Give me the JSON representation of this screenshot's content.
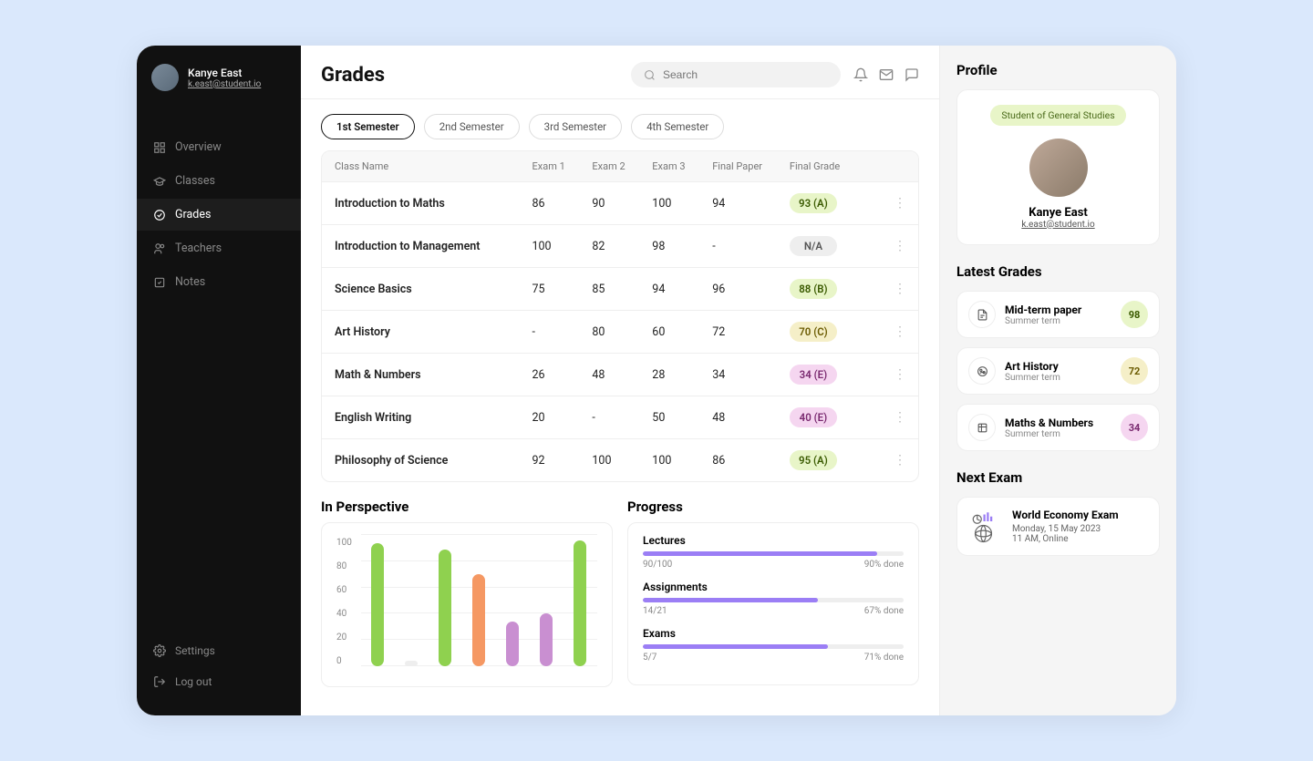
{
  "user": {
    "name": "Kanye East",
    "email": "k.east@student.io"
  },
  "nav": {
    "items": [
      {
        "label": "Overview"
      },
      {
        "label": "Classes"
      },
      {
        "label": "Grades"
      },
      {
        "label": "Teachers"
      },
      {
        "label": "Notes"
      }
    ],
    "footer": [
      {
        "label": "Settings"
      },
      {
        "label": "Log out"
      }
    ]
  },
  "page_title": "Grades",
  "search": {
    "placeholder": "Search"
  },
  "tabs": [
    {
      "label": "1st Semester"
    },
    {
      "label": "2nd Semester"
    },
    {
      "label": "3rd Semester"
    },
    {
      "label": "4th Semester"
    }
  ],
  "table": {
    "headers": [
      "Class Name",
      "Exam 1",
      "Exam 2",
      "Exam 3",
      "Final Paper",
      "Final Grade"
    ],
    "rows": [
      {
        "name": "Introduction to Maths",
        "e1": "86",
        "e2": "90",
        "e3": "100",
        "paper": "94",
        "final": "93 (A)",
        "pill": "green"
      },
      {
        "name": "Introduction to Management",
        "e1": "100",
        "e2": "82",
        "e3": "98",
        "paper": "-",
        "final": "N/A",
        "pill": "gray"
      },
      {
        "name": "Science Basics",
        "e1": "75",
        "e2": "85",
        "e3": "94",
        "paper": "96",
        "final": "88 (B)",
        "pill": "green"
      },
      {
        "name": "Art History",
        "e1": "-",
        "e2": "80",
        "e3": "60",
        "paper": "72",
        "final": "70 (C)",
        "pill": "yellow"
      },
      {
        "name": "Math & Numbers",
        "e1": "26",
        "e2": "48",
        "e3": "28",
        "paper": "34",
        "final": "34 (E)",
        "pill": "pink"
      },
      {
        "name": "English Writing",
        "e1": "20",
        "e2": "-",
        "e3": "50",
        "paper": "48",
        "final": "40 (E)",
        "pill": "pink"
      },
      {
        "name": "Philosophy of Science",
        "e1": "92",
        "e2": "100",
        "e3": "100",
        "paper": "86",
        "final": "95 (A)",
        "pill": "green"
      }
    ]
  },
  "perspective_title": "In Perspective",
  "progress_title": "Progress",
  "chart_data": {
    "type": "bar",
    "ylim": [
      0,
      100
    ],
    "yticks": [
      100,
      80,
      60,
      40,
      20,
      0
    ],
    "series": [
      {
        "value": 93,
        "color": "green"
      },
      {
        "value": 0,
        "color": "gray"
      },
      {
        "value": 88,
        "color": "green"
      },
      {
        "value": 70,
        "color": "orange"
      },
      {
        "value": 34,
        "color": "purple"
      },
      {
        "value": 40,
        "color": "purple"
      },
      {
        "value": 95,
        "color": "green"
      }
    ]
  },
  "progress": [
    {
      "label": "Lectures",
      "done": "90/100",
      "pct": 90,
      "pct_label": "90% done"
    },
    {
      "label": "Assignments",
      "done": "14/21",
      "pct": 67,
      "pct_label": "67% done"
    },
    {
      "label": "Exams",
      "done": "5/7",
      "pct": 71,
      "pct_label": "71% done"
    }
  ],
  "profile": {
    "title": "Profile",
    "badge": "Student of General Studies",
    "name": "Kanye East",
    "email": "k.east@student.io"
  },
  "latest_grades": {
    "title": "Latest Grades",
    "items": [
      {
        "title": "Mid-term paper",
        "sub": "Summer term",
        "score": "98",
        "score_class": "score-green"
      },
      {
        "title": "Art History",
        "sub": "Summer term",
        "score": "72",
        "score_class": "score-yellow"
      },
      {
        "title": "Maths & Numbers",
        "sub": "Summer term",
        "score": "34",
        "score_class": "score-pink"
      }
    ]
  },
  "next_exam": {
    "title": "Next Exam",
    "exam": "World Economy Exam",
    "date": "Monday, 15 May 2023",
    "time": "11 AM, Online"
  }
}
